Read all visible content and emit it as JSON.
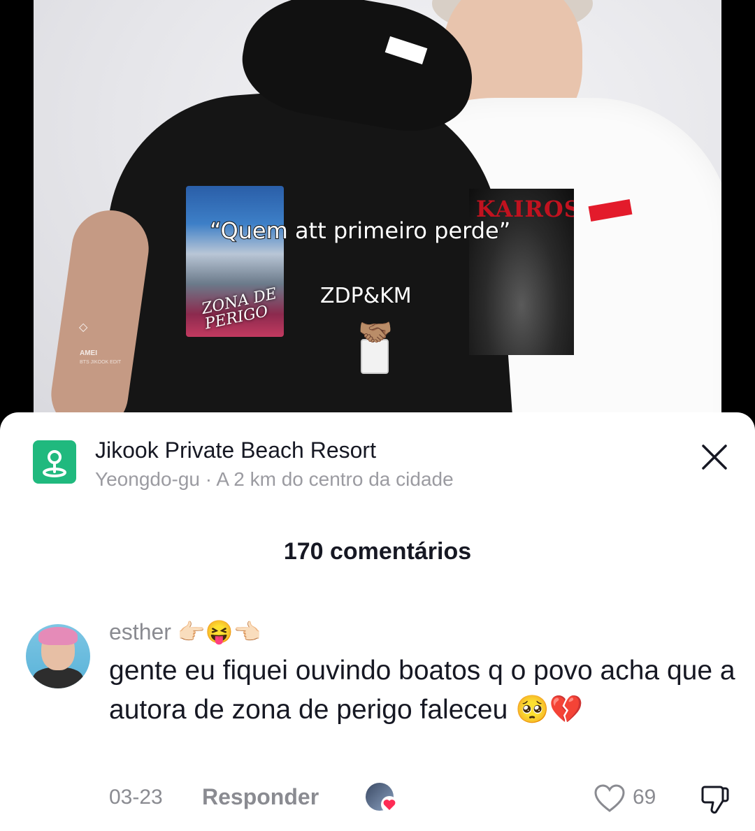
{
  "video": {
    "caption_quote": "“Quem att primeiro perde”",
    "caption_sub": "ZDP&KM",
    "handshake_emoji": "🤝🏽",
    "poster_left_title": "ZONA DE PERIGO",
    "poster_right_title": "KAIROS",
    "watermark_line1": "AMEI",
    "watermark_line2": "BTS JIKOOK EDIT"
  },
  "location": {
    "icon": "location-pin-icon",
    "title": "Jikook Private Beach Resort",
    "subtitle": "Yeongdo-gu · A 2 km do centro da cidade"
  },
  "comments_header": {
    "count_label": "170 comentários"
  },
  "comment": {
    "username": "esther 👉🏻😝👈🏻",
    "text": "gente eu fiquei ouvindo boatos q o povo acha que a autora de zona de perigo faleceu 🥺💔",
    "date": "03-23",
    "reply_label": "Responder",
    "like_count": "69"
  },
  "colors": {
    "accent_green": "#20b97e",
    "muted_text": "#8a8b91",
    "primary_text": "#161823",
    "liked_heart": "#fe2c55"
  }
}
